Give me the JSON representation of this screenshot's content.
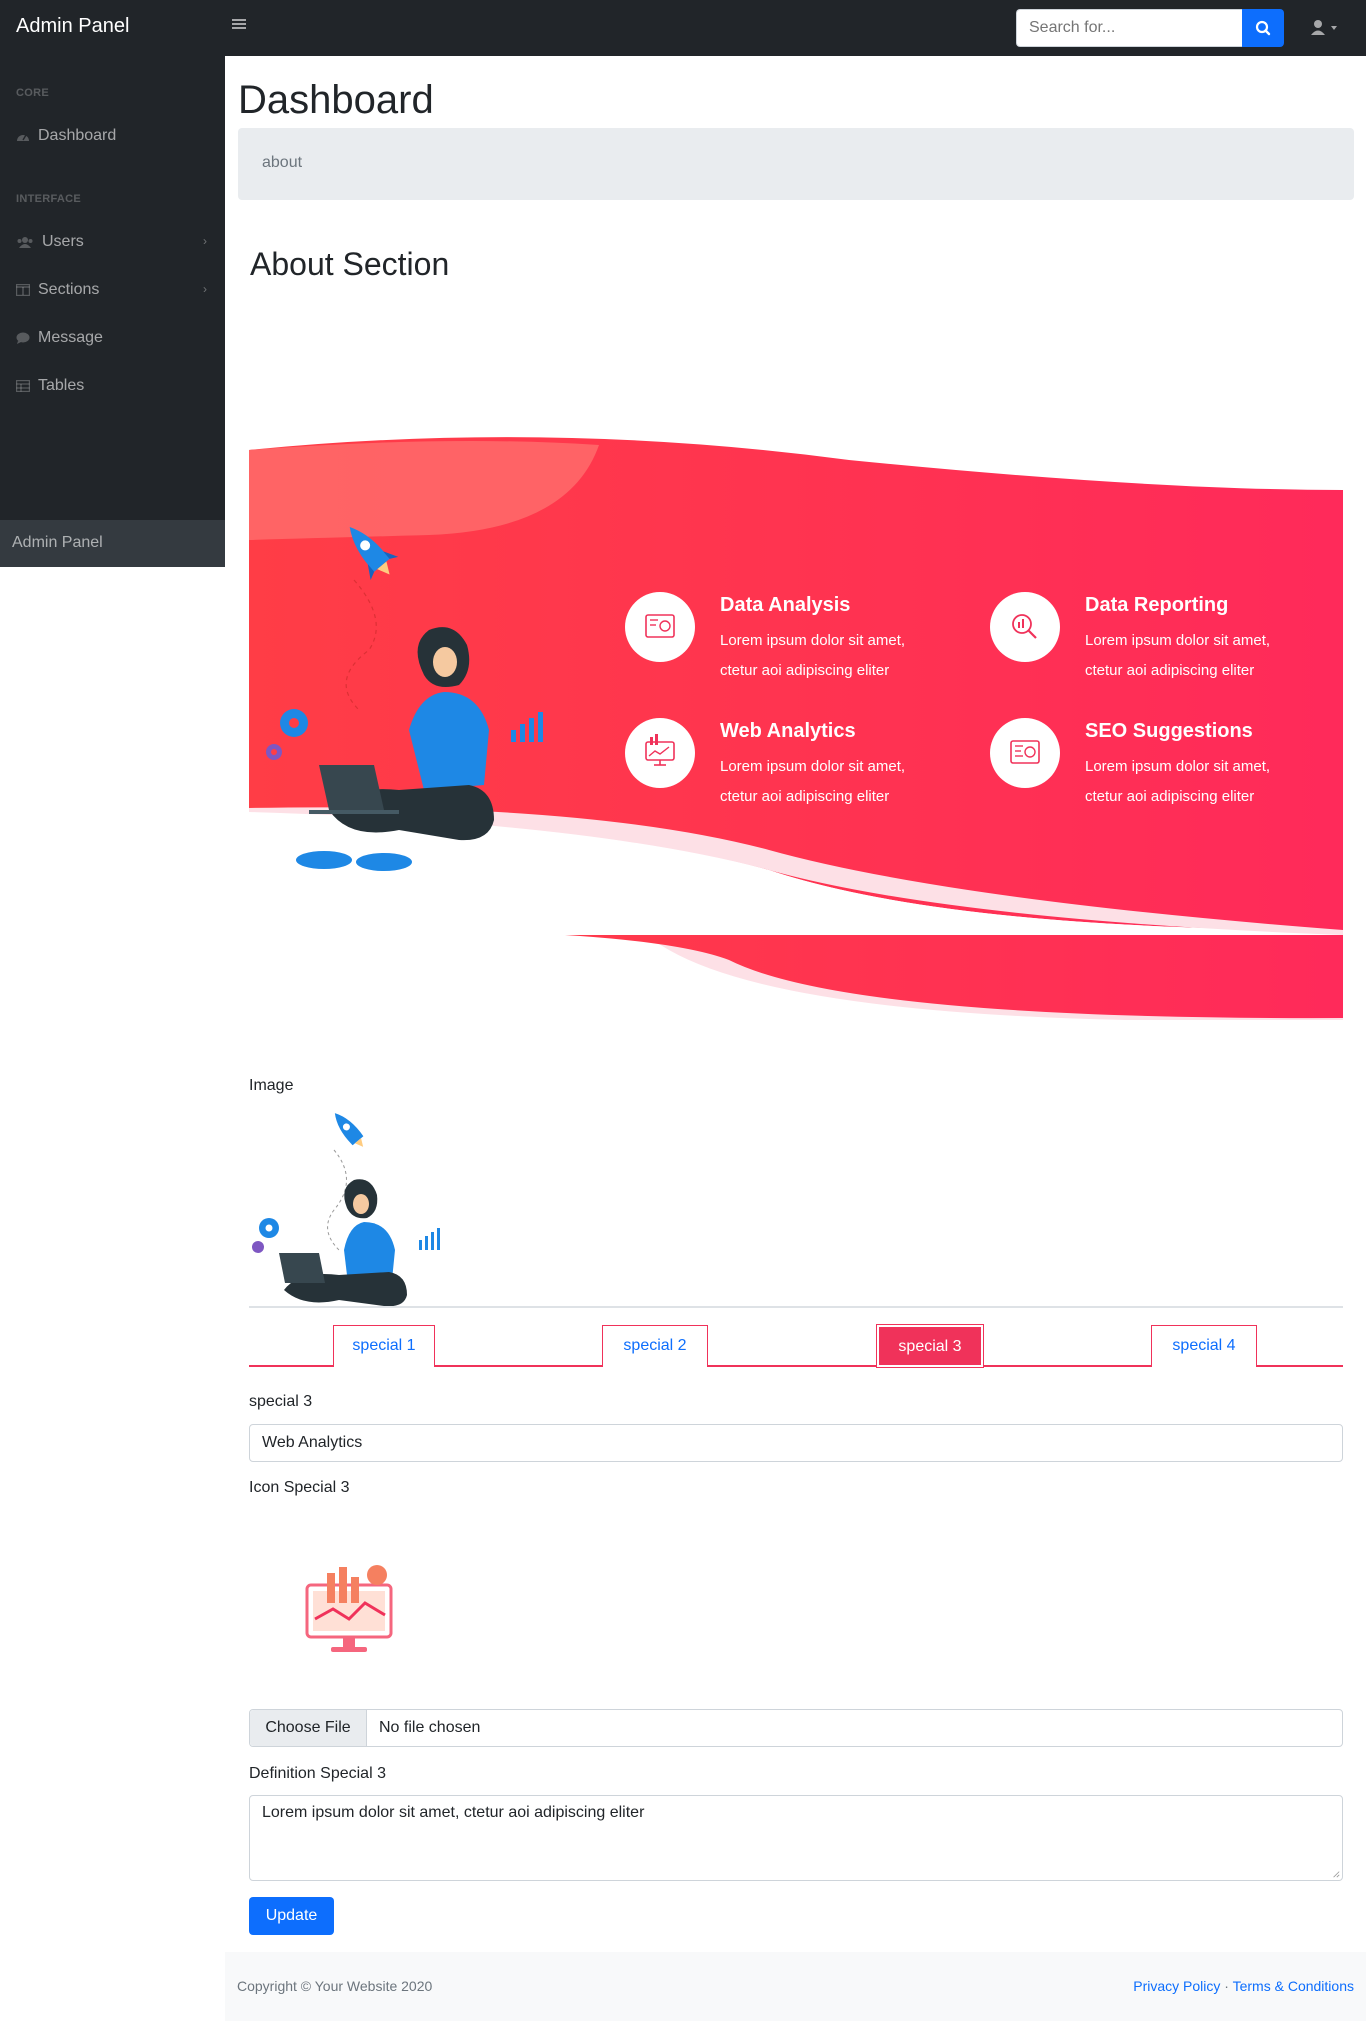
{
  "navbar": {
    "brand": "Admin Panel",
    "toggle_icon": "hamburger-icon",
    "search_placeholder": "Search for...",
    "search_icon": "search-icon",
    "user_icon": "user-icon"
  },
  "sidebar": {
    "headings": [
      "CORE",
      "INTERFACE"
    ],
    "items": [
      {
        "label": "Dashboard",
        "icon": "dashboard-icon"
      },
      {
        "label": "Users",
        "icon": "users-icon",
        "chevron": "›"
      },
      {
        "label": "Sections",
        "icon": "columns-icon",
        "chevron": "›"
      },
      {
        "label": "Message",
        "icon": "message-icon"
      },
      {
        "label": "Tables",
        "icon": "table-icon"
      }
    ],
    "footer": "Admin Panel"
  },
  "main": {
    "title": "Dashboard",
    "breadcrumb": "about",
    "section_title": "About Section"
  },
  "hero": {
    "features": [
      {
        "title": "Data Analysis",
        "line1": "Lorem ipsum dolor sit amet,",
        "line2": "ctetur aoi adipiscing eliter"
      },
      {
        "title": "Data Reporting",
        "line1": "Lorem ipsum dolor sit amet,",
        "line2": "ctetur aoi adipiscing eliter"
      },
      {
        "title": "Web Analytics",
        "line1": "Lorem ipsum dolor sit amet,",
        "line2": "ctetur aoi adipiscing eliter"
      },
      {
        "title": "SEO Suggestions",
        "line1": "Lorem ipsum dolor sit amet,",
        "line2": "ctetur aoi adipiscing eliter"
      }
    ],
    "colors": {
      "primary": "#f0325a",
      "light": "#ff6b6b",
      "accent": "#1e88e5"
    }
  },
  "form": {
    "image_label": "Image",
    "tabs": [
      "special 1",
      "special 2",
      "special 3",
      "special 4"
    ],
    "active_tab": "special 3",
    "special_label": "special 3",
    "special_value": "Web Analytics",
    "icon_label": "Icon Special 3",
    "file_button": "Choose File",
    "file_status": "No file chosen",
    "definition_label": "Definition Special 3",
    "definition_value": "Lorem ipsum dolor sit amet, ctetur aoi adipiscing eliter",
    "update_button": "Update"
  },
  "footer": {
    "copyright": "Copyright © Your Website 2020",
    "privacy": "Privacy Policy",
    "separator": "·",
    "terms": "Terms & Conditions"
  }
}
